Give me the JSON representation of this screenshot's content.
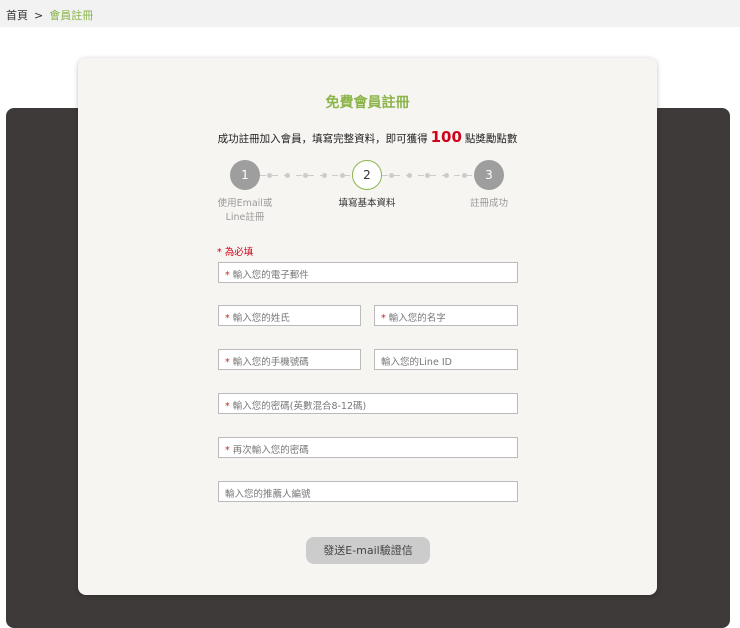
{
  "breadcrumb": {
    "home": "首頁",
    "separator": ">",
    "current": "會員註冊"
  },
  "title": "免費會員註冊",
  "subtitle": {
    "before": "成功註冊加入會員，填寫完整資料，即可獲得",
    "points": "100",
    "after": "點獎勵點數"
  },
  "steps": [
    {
      "number": "1",
      "label": "使用Email或Line註冊"
    },
    {
      "number": "2",
      "label": "填寫基本資料"
    },
    {
      "number": "3",
      "label": "註冊成功"
    }
  ],
  "current_step": 2,
  "required_note": "* 為必填",
  "fields": {
    "email": "輸入您的電子郵件",
    "last_name": "輸入您的姓氏",
    "first_name": "輸入您的名字",
    "phone": "輸入您的手機號碼",
    "line_id": "輸入您的Line ID",
    "password": "輸入您的密碼(英數混合8-12碼)",
    "password_confirm": "再次輸入您的密碼",
    "referrer": "輸入您的推薦人編號"
  },
  "required_star": "*",
  "submit": "發送E-mail驗證信"
}
